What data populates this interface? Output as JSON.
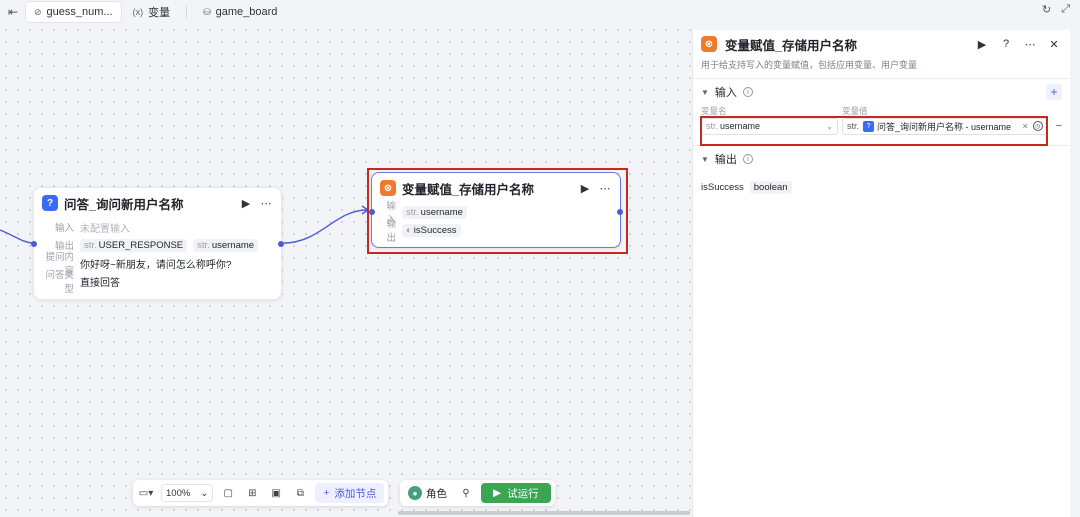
{
  "topbar": {
    "tabs": [
      {
        "label": "guess_num...",
        "active": true
      },
      {
        "label": "变量",
        "active": false
      },
      {
        "label": "game_board",
        "active": false
      }
    ]
  },
  "nodes": {
    "qa": {
      "title": "问答_询问新用户名称",
      "input_label": "输入",
      "input_value": "未配置输入",
      "output_label": "输出",
      "outputs": [
        {
          "type": "str.",
          "name": "USER_RESPONSE"
        },
        {
          "type": "str.",
          "name": "username"
        }
      ],
      "question_label": "提问内容",
      "question_value": "你好呀~新朋友，请问怎么称呼你?",
      "answer_type_label": "问答类型",
      "answer_type_value": "直接回答"
    },
    "assign": {
      "title": "变量赋值_存储用户名称",
      "input_label": "输入",
      "input_type": "str.",
      "input_value": "username",
      "output_label": "输出",
      "output_value": "isSuccess"
    }
  },
  "toolbar": {
    "zoom": "100%",
    "add_node": "添加节点",
    "role": "角色",
    "run": "试运行"
  },
  "panel": {
    "title": "变量赋值_存储用户名称",
    "description": "用于给支持写入的变量赋值，包括应用变量、用户变量",
    "input_section": "输入",
    "col_var_name": "变量名",
    "col_var_value": "变量值",
    "var_name_type": "str.",
    "var_name_value": "username",
    "var_value_type": "str.",
    "var_value_ref": "问答_询问新用户名称 - username",
    "output_section": "输出",
    "output_name": "isSuccess",
    "output_type": "boolean"
  },
  "colors": {
    "highlight": "#c8281e",
    "accent": "#4d5bd8",
    "run": "#3aa651",
    "assign_icon": "#f07a2b",
    "qa_icon": "#3b6bf5"
  }
}
